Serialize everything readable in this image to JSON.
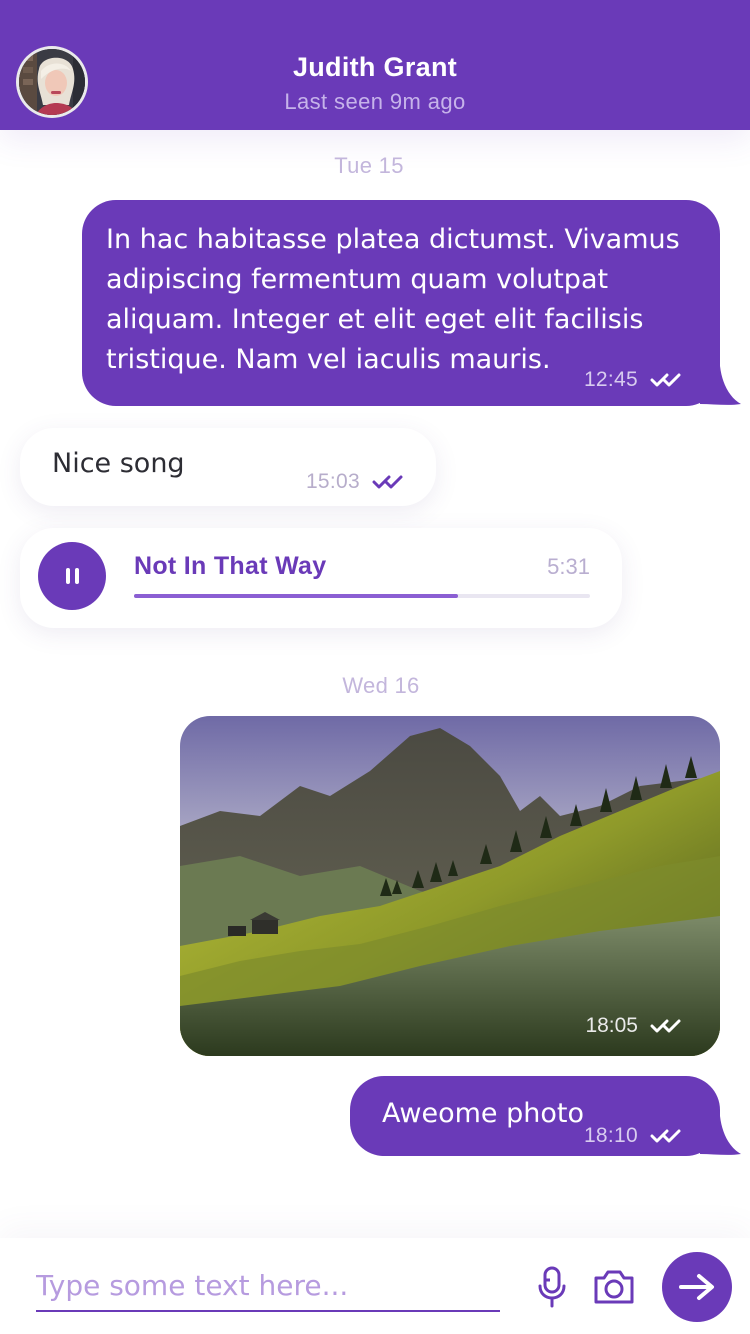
{
  "theme": {
    "accent": "#6a3ab8",
    "light_text": "#c6b3ea"
  },
  "header": {
    "contact_name": "Judith Grant",
    "status": "Last seen 9m ago",
    "avatar_icon": "profile-photo"
  },
  "messages": {
    "day1": "Tue 15",
    "m1": {
      "text": "In hac habitasse platea dictumst. Vivamus adipiscing fermentum quam volutpat aliquam. Integer et elit eget elit facilisis tristique. Nam vel iaculis mauris.",
      "time": "12:45"
    },
    "m2": {
      "text": "Nice song",
      "time": "15:03"
    },
    "audio": {
      "title": "Not In That Way",
      "duration": "5:31",
      "progress": 0.71,
      "control_icon": "pause-icon"
    },
    "day2": "Wed 16",
    "photo": {
      "time": "18:05"
    },
    "m3": {
      "text": "Aweome photo",
      "time": "18:10"
    }
  },
  "composer": {
    "placeholder": "Type some text here...",
    "mic_icon": "microphone-icon",
    "camera_icon": "camera-icon",
    "send_icon": "arrow-right-icon"
  }
}
